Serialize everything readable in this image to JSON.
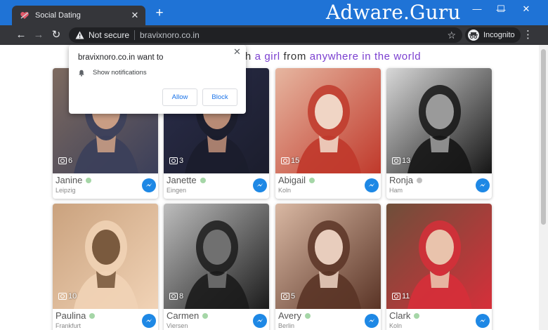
{
  "browser": {
    "tab_title": "Social Dating",
    "tab_close": "✕",
    "new_tab": "+",
    "watermark": "Adware.Guru",
    "window_controls": {
      "minimize": "—",
      "maximize": "☐",
      "close": "✕"
    },
    "nav": {
      "back": "←",
      "forward": "→",
      "reload": "↻"
    },
    "security_label": "Not secure",
    "url": "bravixnoro.co.in",
    "star": "☆",
    "incognito_label": "Incognito",
    "menu": "⋮",
    "colors": {
      "titlebar": "#1f73d6",
      "toolbar": "#35363a",
      "omnibox": "#202124"
    }
  },
  "page": {
    "headline": {
      "lead": "ch",
      "girl": "a girl",
      "from": "from",
      "anywhere": "anywhere in the world"
    },
    "accent_color": "#7b3fd0",
    "profiles": [
      {
        "name": "Janine",
        "city": "Leipzig",
        "photos": "6",
        "online": true,
        "palette": [
          "#7d6a5f",
          "#3b3f5a",
          "#c99d84"
        ]
      },
      {
        "name": "Janette",
        "city": "Eingen",
        "photos": "3",
        "online": true,
        "palette": [
          "#2a2d4a",
          "#1b1d2c",
          "#b88b75"
        ]
      },
      {
        "name": "Abigail",
        "city": "Koln",
        "photos": "15",
        "online": true,
        "palette": [
          "#e6b6a0",
          "#c0392b",
          "#f0d5c5"
        ]
      },
      {
        "name": "Ronja",
        "city": "Ham",
        "photos": "13",
        "online": false,
        "palette": [
          "#d8d8d8",
          "#151515",
          "#9a9a9a"
        ]
      },
      {
        "name": "Paulina",
        "city": "Frankfurt",
        "photos": "10",
        "online": true,
        "palette": [
          "#caa27e",
          "#f1d3b6",
          "#7a5a3e"
        ]
      },
      {
        "name": "Carmen",
        "city": "Viersen",
        "photos": "8",
        "online": true,
        "palette": [
          "#bdbdbd",
          "#1b1b1b",
          "#707070"
        ]
      },
      {
        "name": "Avery",
        "city": "Berlin",
        "photos": "5",
        "online": true,
        "palette": [
          "#d9b8a3",
          "#5a3426",
          "#e8cdbd"
        ]
      },
      {
        "name": "Clark",
        "city": "Koln",
        "photos": "11",
        "online": true,
        "palette": [
          "#6e4f3a",
          "#d62f3a",
          "#e9c3ac"
        ]
      }
    ],
    "online_color": "#a5d6a7",
    "offline_color": "#c0c0c0",
    "messenger_icon": "messenger-icon"
  },
  "popup": {
    "title": "bravixnoro.co.in want to",
    "permission": "Show notifications",
    "allow_label": "Allow",
    "block_label": "Block",
    "close": "✕"
  }
}
